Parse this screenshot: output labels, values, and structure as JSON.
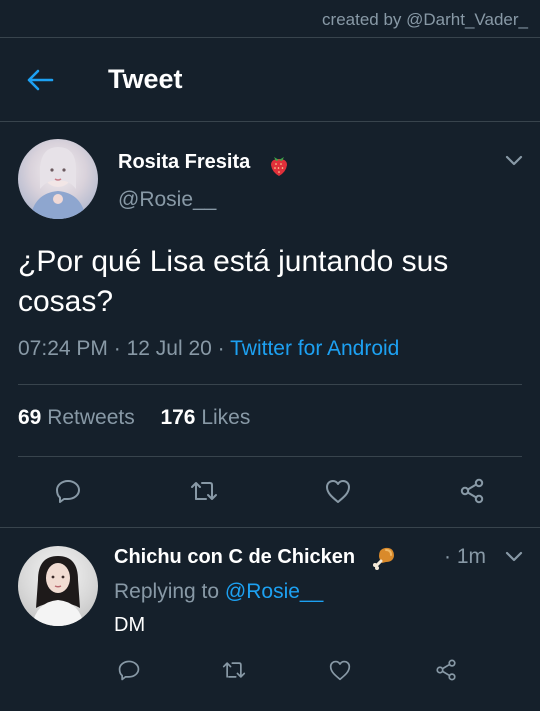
{
  "watermark": "created by @Darht_Vader_",
  "header": {
    "title": "Tweet",
    "back_icon": "arrow-left-icon"
  },
  "tweet": {
    "author_name": "Rosita Fresita",
    "author_emoji": "strawberry-icon",
    "author_handle": "@Rosie__",
    "text": "¿Por qué Lisa está juntando sus cosas?",
    "time": "07:24 PM",
    "sep1": "·",
    "date": "12 Jul 20",
    "sep2": "·",
    "source": "Twitter for Android",
    "retweets_count": "69",
    "retweets_label": "Retweets",
    "likes_count": "176",
    "likes_label": "Likes",
    "actions": [
      "reply-icon",
      "retweet-icon",
      "like-icon",
      "share-icon"
    ]
  },
  "reply": {
    "author_name": "Chichu con C de Chicken",
    "author_emoji": "poultry-leg-icon",
    "time": "· 1m",
    "replying_prefix": "Replying to",
    "replying_handle": "@Rosie__",
    "text": "DM",
    "actions": [
      "reply-icon",
      "retweet-icon",
      "like-icon",
      "share-icon"
    ]
  },
  "colors": {
    "background": "#15202b",
    "divider": "#38444d",
    "secondary_text": "#8899a6",
    "accent": "#1da1f2"
  }
}
